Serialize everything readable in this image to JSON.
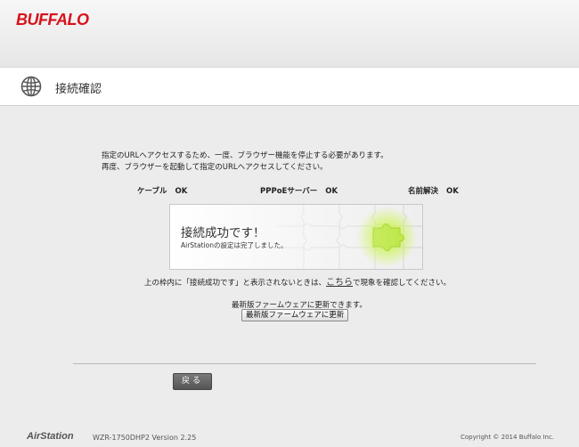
{
  "brand": {
    "logo": "BUFFALO",
    "accent": "#d8121b"
  },
  "header": {
    "title": "接続確認",
    "icon": "globe-icon"
  },
  "message": {
    "line1": "指定のURLへアクセスするため、一度、ブラウザー機能を停止する必要があります。",
    "line2": "再度、ブラウザーを起動して指定のURLへアクセスしてください。"
  },
  "status": [
    {
      "label": "ケーブル",
      "value": "OK"
    },
    {
      "label": "PPPoEサーバー",
      "value": "OK"
    },
    {
      "label": "名前解決",
      "value": "OK"
    }
  ],
  "result": {
    "title": "接続成功です！",
    "subtitle": "AirStationの設定は完了しました。"
  },
  "note": {
    "prefix": "上の枠内に「接続成功です」と表示されないときは、",
    "link": "こちら",
    "suffix": "で現象を確認してください。"
  },
  "firmware": {
    "message": "最新版ファームウェアに更新できます。",
    "button": "最新版ファームウェアに更新"
  },
  "back_button": "戻る",
  "footer": {
    "logo": "AirStation",
    "model": "WZR-1750DHP2   Version 2.25",
    "copyright": "Copyright © 2014 Buffalo Inc."
  }
}
